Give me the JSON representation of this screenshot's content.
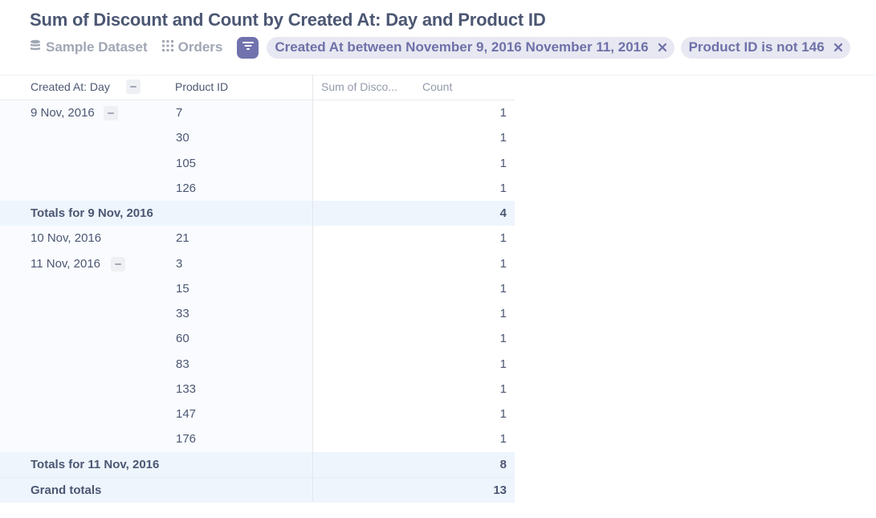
{
  "title": "Sum of Discount and Count by Created At: Day and Product ID",
  "breadcrumbs": {
    "database": {
      "label": "Sample Dataset",
      "icon": "database-icon"
    },
    "table": {
      "label": "Orders",
      "icon": "grid-icon"
    }
  },
  "filters": [
    {
      "label": "Created At between November 9, 2016 November 11, 2016"
    },
    {
      "label": "Product ID is not 146"
    }
  ],
  "columns": {
    "created_at": "Created At: Day",
    "product_id": "Product ID",
    "sum_discount": "Sum of Disco...",
    "count": "Count"
  },
  "rows": [
    {
      "date": "9 Nov, 2016",
      "product": "7",
      "count": "1"
    },
    {
      "date": "",
      "product": "30",
      "count": "1"
    },
    {
      "date": "",
      "product": "105",
      "count": "1"
    },
    {
      "date": "",
      "product": "126",
      "count": "1"
    },
    {
      "total_label": "Totals for 9 Nov, 2016",
      "count": "4"
    },
    {
      "date": "10 Nov, 2016",
      "product": "21",
      "count": "1"
    },
    {
      "date": "11 Nov, 2016",
      "product": "3",
      "count": "1"
    },
    {
      "date": "",
      "product": "15",
      "count": "1"
    },
    {
      "date": "",
      "product": "33",
      "count": "1"
    },
    {
      "date": "",
      "product": "60",
      "count": "1"
    },
    {
      "date": "",
      "product": "83",
      "count": "1"
    },
    {
      "date": "",
      "product": "133",
      "count": "1"
    },
    {
      "date": "",
      "product": "147",
      "count": "1"
    },
    {
      "date": "",
      "product": "176",
      "count": "1"
    },
    {
      "total_label": "Totals for 11 Nov, 2016",
      "count": "8"
    },
    {
      "total_label": "Grand totals",
      "count": "13"
    }
  ],
  "colors": {
    "accent": "#7172ad",
    "pill_bg": "#e7e8f1",
    "total_bg": "#eef5fd"
  }
}
